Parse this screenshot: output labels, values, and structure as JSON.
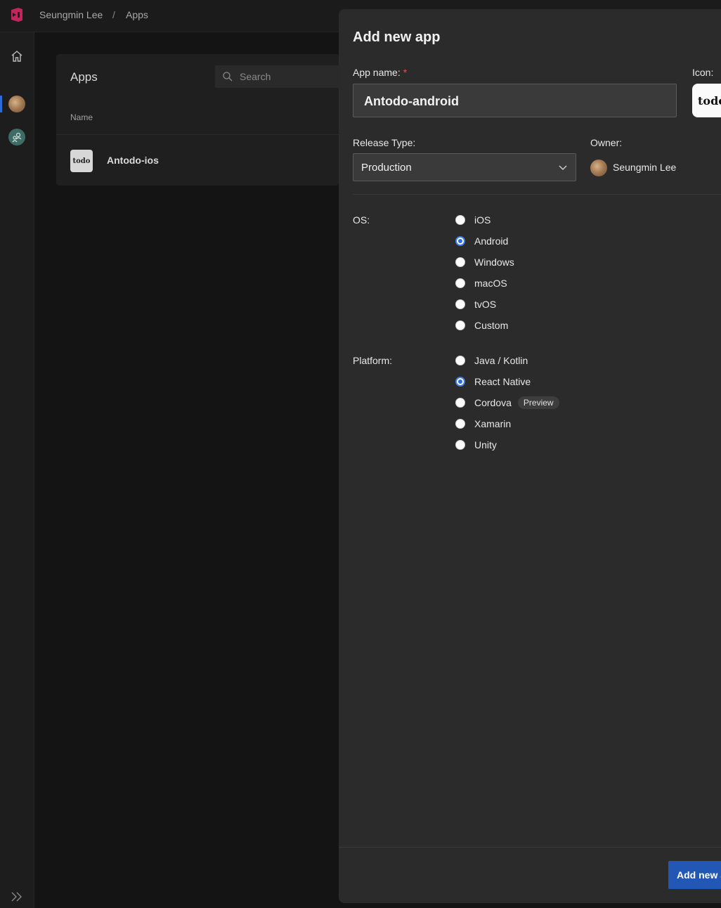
{
  "header": {
    "owner": "Seungmin Lee",
    "separator": "/",
    "section": "Apps"
  },
  "rail": {
    "icons": [
      "home-icon",
      "user-avatar",
      "organization-icon",
      "expand-icon"
    ]
  },
  "apps_list": {
    "title": "Apps",
    "search_placeholder": "Search",
    "column_name": "Name",
    "rows": [
      {
        "icon_text": "todo",
        "name": "Antodo-ios"
      }
    ]
  },
  "panel": {
    "title": "Add new app",
    "app_name_label": "App name:",
    "required_mark": "*",
    "app_name_value": "Antodo-android",
    "icon_label": "Icon:",
    "icon_text": "todo",
    "release_type_label": "Release Type:",
    "release_type_value": "Production",
    "owner_label": "Owner:",
    "owner_name": "Seungmin Lee",
    "os_label": "OS:",
    "os_options": [
      {
        "label": "iOS",
        "selected": false
      },
      {
        "label": "Android",
        "selected": true
      },
      {
        "label": "Windows",
        "selected": false
      },
      {
        "label": "macOS",
        "selected": false
      },
      {
        "label": "tvOS",
        "selected": false
      },
      {
        "label": "Custom",
        "selected": false
      }
    ],
    "platform_label": "Platform:",
    "platform_options": [
      {
        "label": "Java / Kotlin",
        "selected": false
      },
      {
        "label": "React Native",
        "selected": true
      },
      {
        "label": "Cordova",
        "selected": false,
        "badge": "Preview"
      },
      {
        "label": "Xamarin",
        "selected": false
      },
      {
        "label": "Unity",
        "selected": false
      }
    ],
    "submit_label": "Add new app"
  },
  "colors": {
    "accent": "#2357b5",
    "radio_selected": "#2f6bd6",
    "required": "#e0534a",
    "logo": "#c2255c"
  }
}
